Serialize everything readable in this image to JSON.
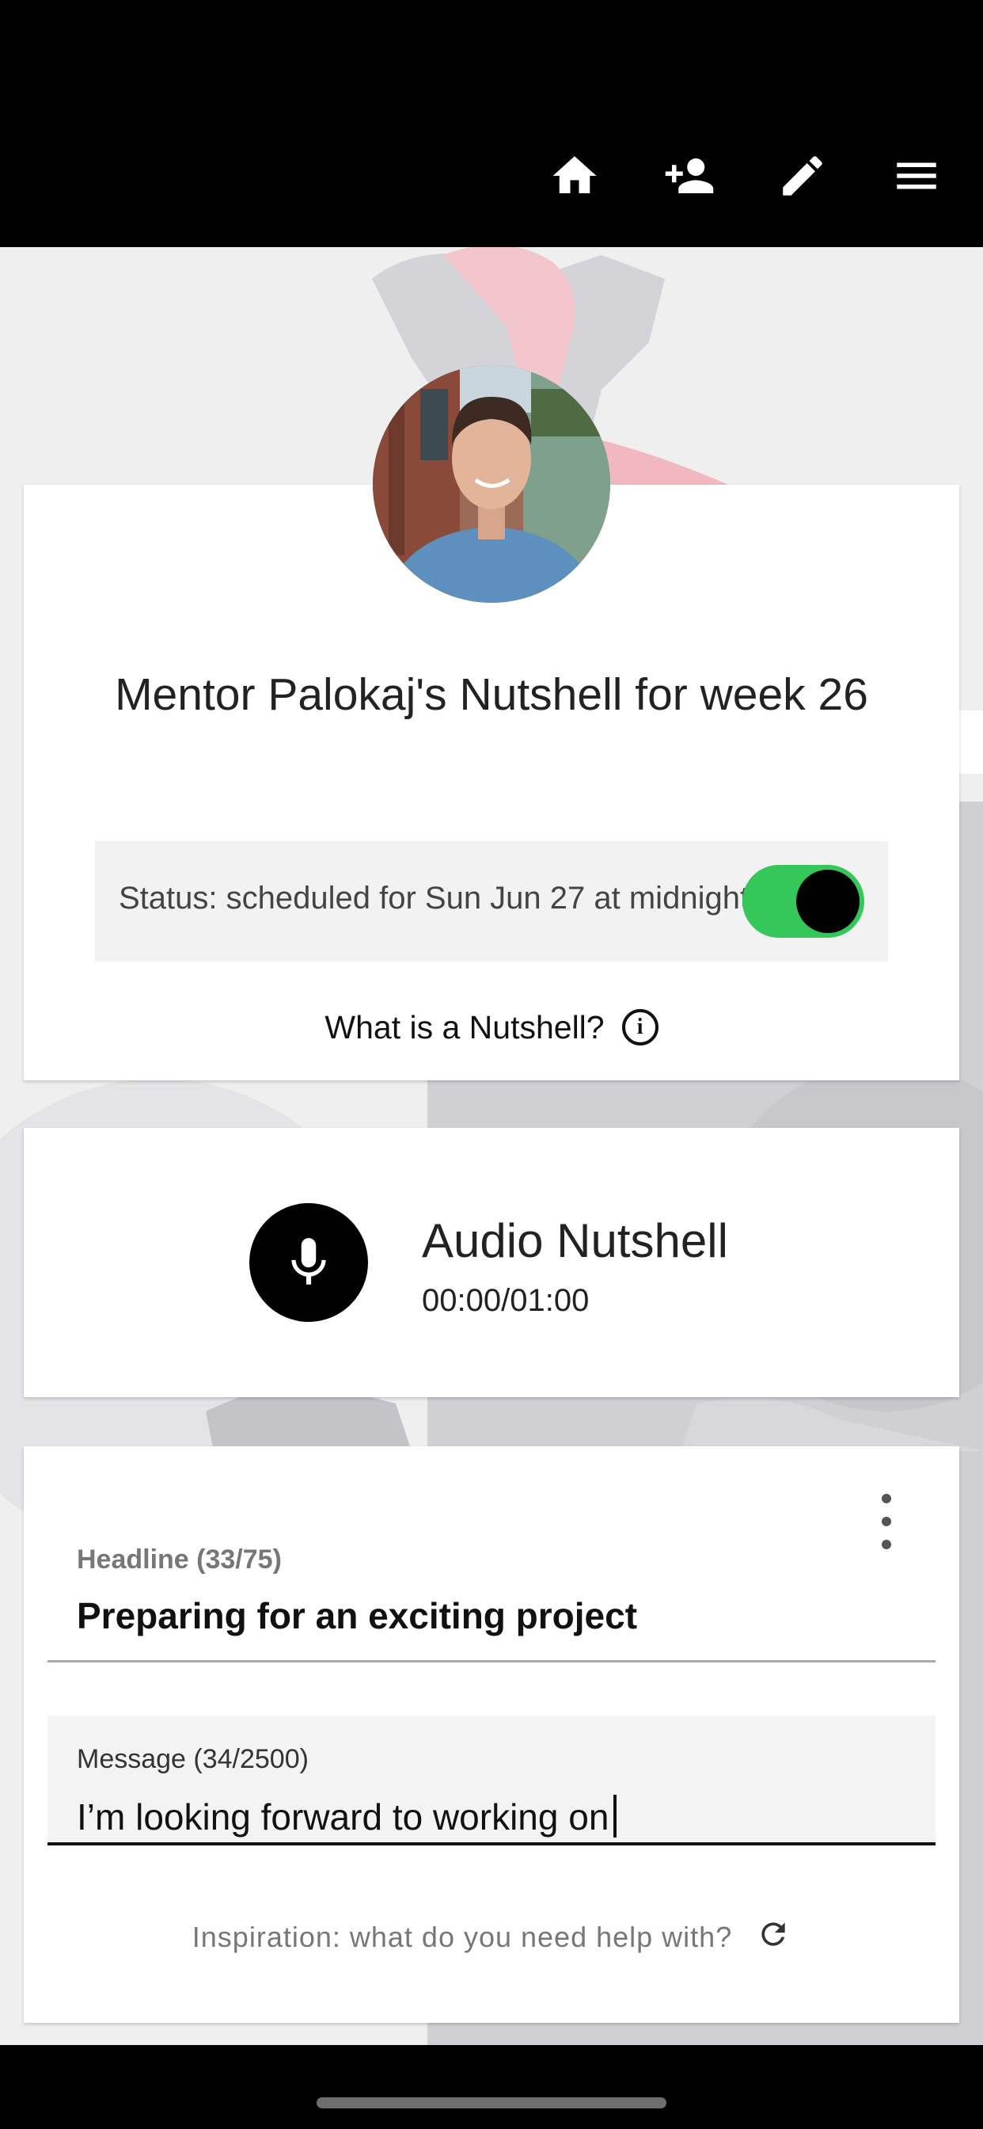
{
  "nav": {
    "icons": [
      "home-icon",
      "add-person-icon",
      "pencil-icon",
      "menu-icon"
    ]
  },
  "profile_card": {
    "title": "Mentor Palokaj's Nutshell for week 26",
    "status_text": "Status: scheduled for Sun Jun 27 at midnight",
    "toggle_on": true,
    "what_is_label": "What is a Nutshell?"
  },
  "audio_card": {
    "title": "Audio Nutshell",
    "time": "00:00/01:00"
  },
  "editor_card": {
    "headline_label": "Headline (33/75)",
    "headline_value": "Preparing for an exciting project",
    "message_label": "Message (34/2500)",
    "message_value": "I’m looking forward to working on",
    "inspiration": "Inspiration: what do you need help with?"
  },
  "colors": {
    "toggle_on": "#35c759",
    "top_bar": "#000000"
  }
}
